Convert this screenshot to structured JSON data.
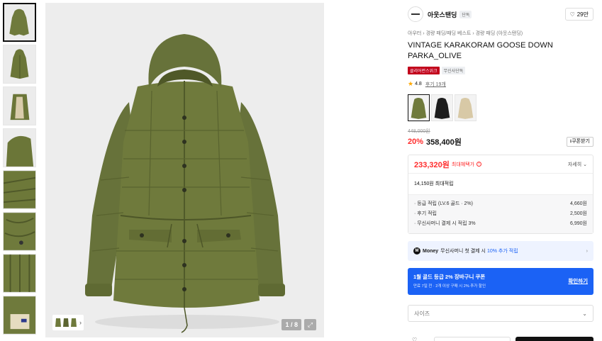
{
  "colors": {
    "accent_red": "#ff2b2b",
    "accent_blue": "#1b62f5",
    "jacket_olive": "#6f7a3c",
    "badge_red": "#c2001b"
  },
  "gallery": {
    "pager": "1 / 8",
    "thumbnail_count": 8
  },
  "brand": {
    "name": "아웃스탠딩",
    "tag": "단독",
    "likes": "29만"
  },
  "breadcrumb": [
    "아우터",
    "경량 패딩/패딩 베스트",
    "경량 패딩 (아웃스탠딩)"
  ],
  "product": {
    "title": "VINTAGE KARAKORAM GOOSE DOWN PARKA_OLIVE",
    "badge_primary": "클리어런스위크",
    "badge_secondary": "무신사단독",
    "rating": "4.8",
    "review_link": "후기 19개",
    "original_price": "448,000원",
    "discount": "20%",
    "sale_price": "358,400원",
    "coupon_button": "쿠폰받기",
    "swatches": [
      "olive",
      "black",
      "beige"
    ]
  },
  "benefit": {
    "max_price": "233,320원",
    "max_label": "최대혜택가",
    "detail_link": "자세히",
    "points_total": "14,150원 최대적립",
    "points": [
      {
        "label": "· 등급 적립 (LV.6 골드 · 2%)",
        "value": "4,660원"
      },
      {
        "label": "· 후기 적립",
        "value": "2,500원"
      },
      {
        "label": "· 무신사머니 결제 시 적립 3%",
        "value": "6,990원"
      }
    ]
  },
  "money_banner": {
    "icon_text": "M",
    "brand": "Money",
    "text_before": "무신사머니 첫 결제 시",
    "highlight": "10% 추가 적립"
  },
  "coupon_banner": {
    "title": "1월 골드 등급 2% 장바구니 쿠폰",
    "subtitle": "만료 7일 전 · 2개 이상 구매 시 2% 추가 할인",
    "action": "확인하기"
  },
  "size_select": {
    "placeholder": "사이즈"
  }
}
